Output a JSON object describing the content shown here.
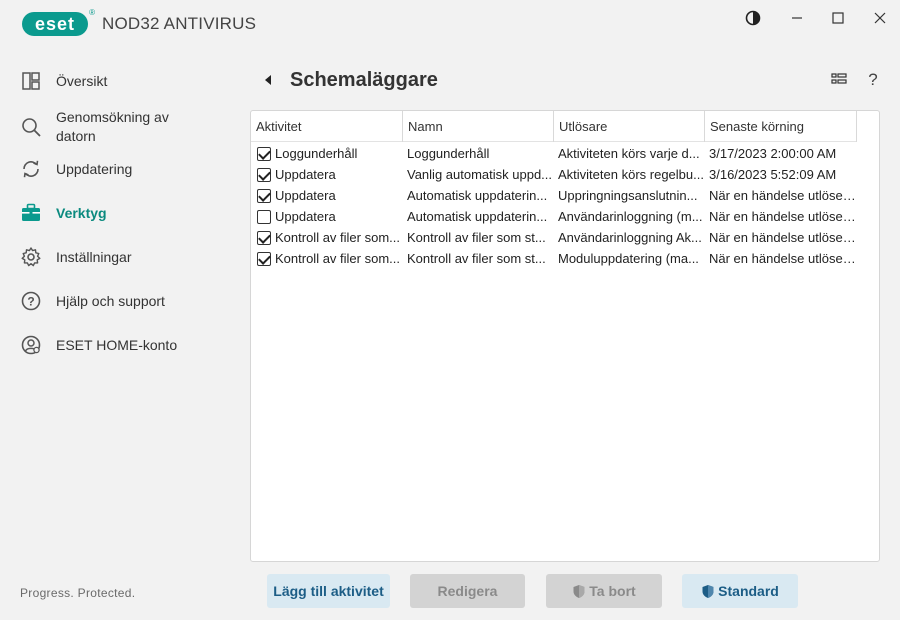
{
  "app": {
    "logo_text": "eset",
    "logo_reg": "®",
    "product_name": "NOD32 ANTIVIRUS",
    "brand_color": "#0b9a8e"
  },
  "window_controls": [
    "contrast-icon",
    "minimize-icon",
    "maximize-icon",
    "close-icon"
  ],
  "sidebar": {
    "items": [
      {
        "label": "Översikt",
        "icon": "overview-icon"
      },
      {
        "label": "Genomsökning av datorn",
        "icon": "scan-icon"
      },
      {
        "label": "Uppdatering",
        "icon": "update-icon"
      },
      {
        "label": "Verktyg",
        "icon": "briefcase-icon",
        "active": true
      },
      {
        "label": "Inställningar",
        "icon": "gear-icon"
      },
      {
        "label": "Hjälp och support",
        "icon": "help-icon"
      },
      {
        "label": "ESET HOME-konto",
        "icon": "account-icon"
      }
    ],
    "footer": "Progress. Protected."
  },
  "header": {
    "title": "Schemaläggare",
    "icons": [
      "view-toggle-icon",
      "help-icon"
    ],
    "help_glyph": "?"
  },
  "table": {
    "columns": [
      "Aktivitet",
      "Namn",
      "Utlösare",
      "Senaste körning"
    ],
    "rows": [
      {
        "checked": true,
        "activity": "Loggunderhåll",
        "name": "Loggunderhåll",
        "trigger": "Aktiviteten körs varje d...",
        "last_run": "3/17/2023 2:00:00 AM"
      },
      {
        "checked": true,
        "activity": "Uppdatera",
        "name": "Vanlig automatisk uppd...",
        "trigger": "Aktiviteten körs regelbu...",
        "last_run": "3/16/2023 5:52:09 AM"
      },
      {
        "checked": true,
        "activity": "Uppdatera",
        "name": "Automatisk uppdaterin...",
        "trigger": "Uppringningsanslutnin...",
        "last_run": "När en händelse utlöser..."
      },
      {
        "checked": false,
        "activity": "Uppdatera",
        "name": "Automatisk uppdaterin...",
        "trigger": "Användarinloggning (m...",
        "last_run": "När en händelse utlöser..."
      },
      {
        "checked": true,
        "activity": "Kontroll av filer som...",
        "name": "Kontroll av filer som st...",
        "trigger": "Användarinloggning Ak...",
        "last_run": "När en händelse utlöser..."
      },
      {
        "checked": true,
        "activity": "Kontroll av filer som...",
        "name": "Kontroll av filer som st...",
        "trigger": "Moduluppdatering (ma...",
        "last_run": "När en händelse utlöser..."
      }
    ]
  },
  "buttons": {
    "add": "Lägg till aktivitet",
    "edit": "Redigera",
    "delete": "Ta bort",
    "default": "Standard"
  }
}
